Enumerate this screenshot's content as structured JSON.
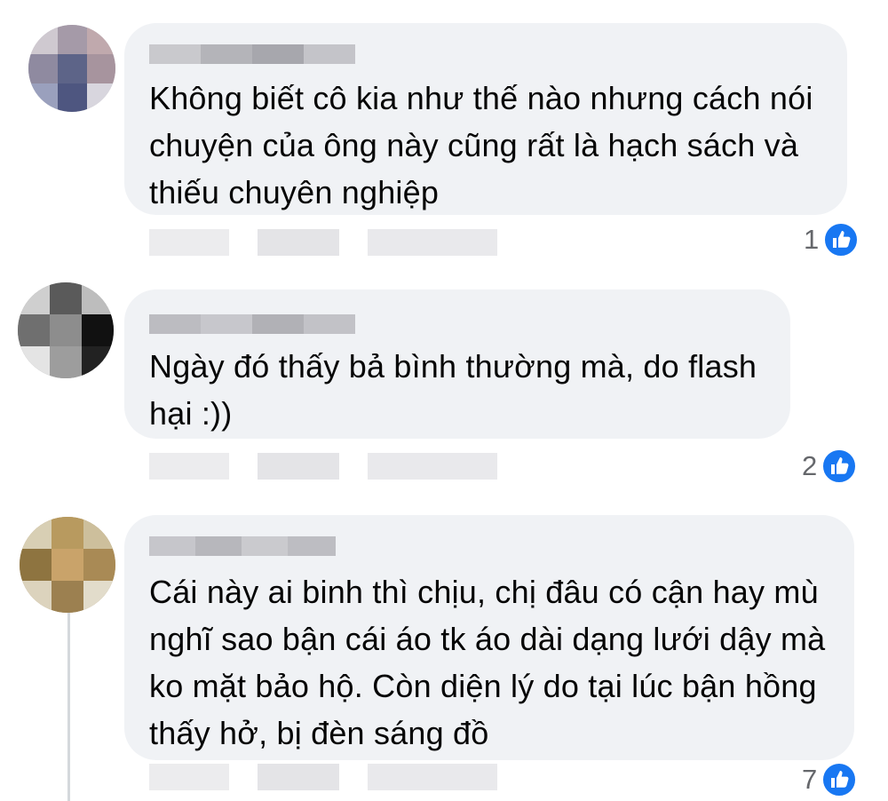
{
  "comments": [
    {
      "text": "Không biết cô kia như thế nào nhưng cách nói chuyện của ông này cũng rất là hạch sách và thiếu chuyên nghiệp",
      "like_count": "1",
      "like_icon": "thumbs-up-icon"
    },
    {
      "text": "Ngày đó thấy bả bình thường mà, do flash hại :))",
      "like_count": "2",
      "like_icon": "thumbs-up-icon"
    },
    {
      "text": "Cái này ai binh thì chịu, chị đâu có cận hay mù nghĩ sao bận cái áo tk áo dài dạng lưới dậy mà ko mặt bảo hộ. Còn diện lý do tại lúc bận hồng thấy hở, bị đèn sáng đồ",
      "like_count": "7",
      "like_icon": "thumbs-up-icon"
    }
  ],
  "colors": {
    "bubble": "#f0f2f5",
    "text": "#050505",
    "like_blue": "#1877f2",
    "meta_gray": "#65676b"
  }
}
